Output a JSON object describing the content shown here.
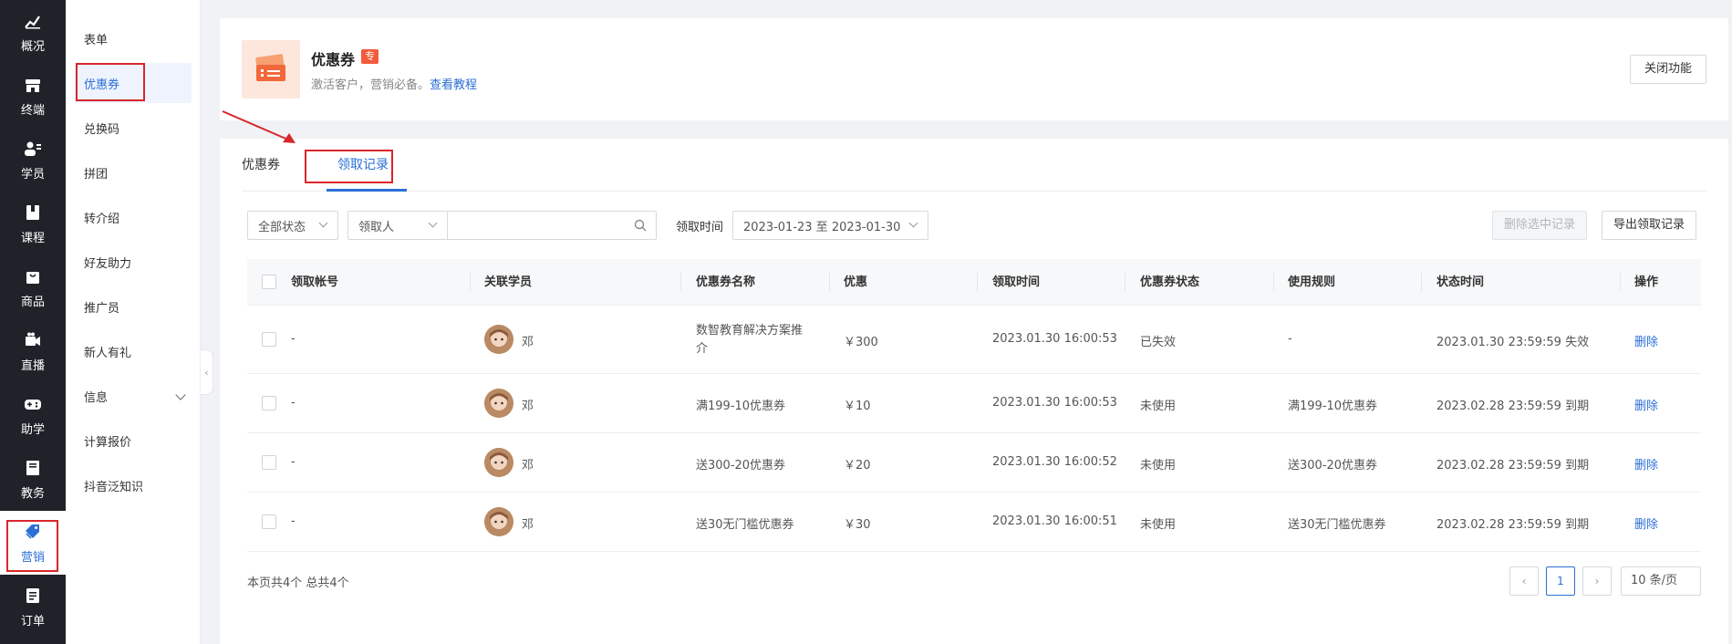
{
  "rail": [
    {
      "label": "概况",
      "icon": "chart-icon"
    },
    {
      "label": "终端",
      "icon": "store-icon"
    },
    {
      "label": "学员",
      "icon": "users-icon"
    },
    {
      "label": "课程",
      "icon": "book-icon"
    },
    {
      "label": "商品",
      "icon": "bag-icon"
    },
    {
      "label": "直播",
      "icon": "video-icon"
    },
    {
      "label": "助学",
      "icon": "gamepad-icon"
    },
    {
      "label": "教务",
      "icon": "notebook-icon"
    },
    {
      "label": "营销",
      "icon": "tag-icon"
    },
    {
      "label": "订单",
      "icon": "order-icon"
    }
  ],
  "subnav": [
    "表单",
    "优惠券",
    "兑换码",
    "拼团",
    "转介绍",
    "好友助力",
    "推广员",
    "新人有礼",
    "信息",
    "计算报价",
    "抖音泛知识"
  ],
  "header": {
    "title": "优惠券",
    "badge": "专",
    "desc": "激活客户，营销必备。",
    "tutorial_link": "查看教程",
    "close_btn": "关闭功能"
  },
  "tabs": [
    "优惠券",
    "领取记录"
  ],
  "filters": {
    "status": "全部状态",
    "person": "领取人",
    "search_placeholder": "",
    "time_label": "领取时间",
    "date_range": "2023-01-23 至 2023-01-30",
    "delete_btn": "删除选中记录",
    "export_btn": "导出领取记录"
  },
  "table": {
    "headers": [
      "领取帐号",
      "关联学员",
      "优惠券名称",
      "优惠",
      "领取时间",
      "优惠券状态",
      "使用规则",
      "状态时间",
      "操作"
    ],
    "rows": [
      {
        "account": "-",
        "student": "邓",
        "name_line1": "数智教育解决方案推",
        "name_line2": "介",
        "discount": "￥300",
        "time": "2023.01.30 16:00:53",
        "status": "已失效",
        "rule": "-",
        "status_time": "2023.01.30 23:59:59 失效",
        "action": "删除"
      },
      {
        "account": "-",
        "student": "邓",
        "name_line1": "满199-10优惠券",
        "name_line2": "",
        "discount": "￥10",
        "time": "2023.01.30 16:00:53",
        "status": "未使用",
        "rule": "满199-10优惠券",
        "status_time": "2023.02.28 23:59:59 到期",
        "action": "删除"
      },
      {
        "account": "-",
        "student": "邓",
        "name_line1": "送300-20优惠券",
        "name_line2": "",
        "discount": "￥20",
        "time": "2023.01.30 16:00:52",
        "status": "未使用",
        "rule": "送300-20优惠券",
        "status_time": "2023.02.28 23:59:59 到期",
        "action": "删除"
      },
      {
        "account": "-",
        "student": "邓",
        "name_line1": "送30无门槛优惠券",
        "name_line2": "",
        "discount": "￥30",
        "time": "2023.01.30 16:00:51",
        "status": "未使用",
        "rule": "送30无门槛优惠券",
        "status_time": "2023.02.28 23:59:59 到期",
        "action": "删除"
      }
    ]
  },
  "footer": {
    "summary": "本页共4个 总共4个",
    "current_page": "1",
    "page_size": "10 条/页"
  },
  "colors": {
    "accent": "#2b6fd6",
    "highlight": "#d9262b",
    "rail_bg": "#1f2229"
  }
}
